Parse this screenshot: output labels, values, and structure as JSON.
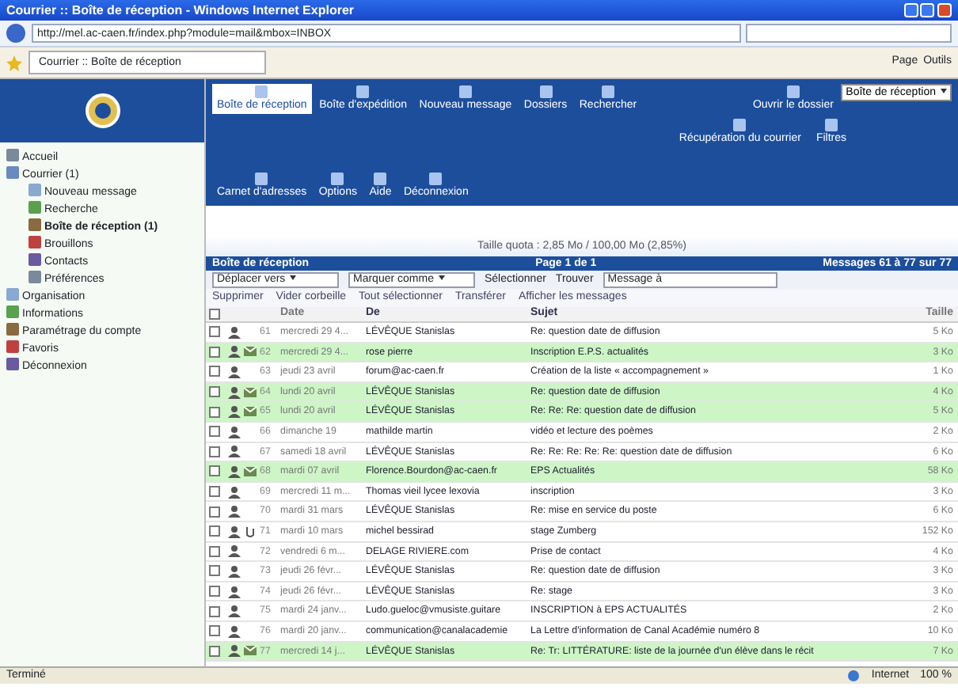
{
  "window": {
    "title": "Courrier :: Boîte de réception - Windows Internet Explorer"
  },
  "browser": {
    "address": "http://mel.ac-caen.fr/index.php?module=mail&mbox=INBOX",
    "tab": "Courrier :: Boîte de réception",
    "commands": [
      "Page",
      "Outils"
    ]
  },
  "sidebar": {
    "items": [
      {
        "label": "Accueil",
        "selected": false
      },
      {
        "label": "Courrier",
        "count": "(1)",
        "selected": false,
        "children": [
          {
            "label": "Nouveau message",
            "selected": false
          },
          {
            "label": "Recherche",
            "selected": false
          },
          {
            "label": "Boîte de réception",
            "count": "(1)",
            "selected": true
          },
          {
            "label": "Brouillons",
            "selected": false
          },
          {
            "label": "Contacts",
            "selected": false
          },
          {
            "label": "Préférences",
            "selected": false
          }
        ]
      },
      {
        "label": "Organisation",
        "selected": false
      },
      {
        "label": "Informations",
        "selected": false
      },
      {
        "label": "Paramétrage du compte",
        "selected": false
      },
      {
        "label": "Favoris",
        "selected": false
      },
      {
        "label": "Déconnexion",
        "selected": false
      }
    ]
  },
  "toolbar": {
    "main": [
      {
        "label": "Boîte de réception",
        "selected": true
      },
      {
        "label": "Boîte d'expédition",
        "selected": false
      },
      {
        "label": "Nouveau message",
        "selected": false
      },
      {
        "label": "Dossiers",
        "selected": false
      },
      {
        "label": "Rechercher",
        "selected": false
      }
    ],
    "open_folder": "Ouvrir le dossier",
    "folder_select": "Boîte de réception",
    "secondary": [
      {
        "label": "Récupération du courrier",
        "selected": false
      },
      {
        "label": "Filtres",
        "selected": false
      }
    ],
    "bottom": [
      {
        "label": "Carnet d'adresses",
        "selected": false
      },
      {
        "label": "Options",
        "selected": false
      },
      {
        "label": "Aide",
        "selected": false
      },
      {
        "label": "Déconnexion",
        "selected": false
      }
    ]
  },
  "quota": "Taille quota : 2,85 Mo / 100,00 Mo (2,85%)",
  "mailbox_bar": {
    "title": "Boîte de réception",
    "page": "Page 1 de 1",
    "messages": "Messages 61 à 77 sur 77"
  },
  "filters": {
    "move": "Déplacer vers",
    "mark": "Marquer comme",
    "select": "Sélectionner",
    "find": "Trouver",
    "search_value": "Message à"
  },
  "actions": [
    "Supprimer",
    "Vider corbeille",
    "Tout sélectionner",
    "Transférer",
    "Afficher les messages"
  ],
  "table": {
    "select_all_checked": false,
    "columns": [
      "Date",
      "De",
      "Sujet",
      "Taille"
    ],
    "rows": [
      {
        "num": "61",
        "date": "mercredi 29 4...",
        "from": "LÉVÊQUE Stanislas",
        "subject": "Re: question date de diffusion",
        "size": "5 Ko",
        "unread": false,
        "attachment": false
      },
      {
        "num": "62",
        "date": "mercredi 29 4...",
        "from": "rose pierre",
        "subject": "Inscription E.P.S. actualités",
        "size": "3 Ko",
        "unread": true,
        "attachment": false
      },
      {
        "num": "63",
        "date": "jeudi 23 avril",
        "from": "forum@ac-caen.fr",
        "subject": "Création de la liste « accompagnement »",
        "size": "1 Ko",
        "unread": false,
        "attachment": false
      },
      {
        "num": "64",
        "date": "lundi 20 avril",
        "from": "LÉVÊQUE Stanislas",
        "subject": "Re: question date de diffusion",
        "size": "4 Ko",
        "unread": true,
        "attachment": false
      },
      {
        "num": "65",
        "date": "lundi 20 avril",
        "from": "LÉVÊQUE Stanislas",
        "subject": "Re: Re: Re: question date de diffusion",
        "size": "5 Ko",
        "unread": true,
        "attachment": false
      },
      {
        "num": "66",
        "date": "dimanche 19",
        "from": "mathilde martin",
        "subject": "vidéo et lecture des poèmes",
        "size": "2 Ko",
        "unread": false,
        "attachment": false
      },
      {
        "num": "67",
        "date": "samedi 18 avril",
        "from": "LÉVÊQUE Stanislas",
        "subject": "Re: Re: Re: Re: Re: question date de diffusion",
        "size": "6 Ko",
        "unread": false,
        "attachment": false
      },
      {
        "num": "68",
        "date": "mardi 07 avril",
        "from": "Florence.Bourdon@ac-caen.fr",
        "subject": "EPS Actualités",
        "size": "58 Ko",
        "unread": true,
        "attachment": false
      },
      {
        "num": "69",
        "date": "mercredi 11 m...",
        "from": "Thomas vieil lycee lexovia",
        "subject": "inscription",
        "size": "3 Ko",
        "unread": false,
        "attachment": false
      },
      {
        "num": "70",
        "date": "mardi 31 mars",
        "from": "LÉVÊQUE Stanislas",
        "subject": "Re: mise en service du poste",
        "size": "6 Ko",
        "unread": false,
        "attachment": false
      },
      {
        "num": "71",
        "date": "mardi 10 mars",
        "from": "michel bessirad",
        "subject": "stage Zumberg",
        "size": "152 Ko",
        "unread": false,
        "attachment": true
      },
      {
        "num": "72",
        "date": "vendredi 6 m...",
        "from": "DELAGE RIVIERE.com",
        "subject": "Prise de contact",
        "size": "4 Ko",
        "unread": false,
        "attachment": false
      },
      {
        "num": "73",
        "date": "jeudi 26 févr...",
        "from": "LÉVÊQUE Stanislas",
        "subject": "Re: question date de diffusion",
        "size": "3 Ko",
        "unread": false,
        "attachment": false
      },
      {
        "num": "74",
        "date": "jeudi 26 févr...",
        "from": "LÉVÊQUE Stanislas",
        "subject": "Re: stage",
        "size": "3 Ko",
        "unread": false,
        "attachment": false
      },
      {
        "num": "75",
        "date": "mardi 24 janv...",
        "from": "Ludo.gueloc@vmusiste.guitare",
        "subject": "INSCRIPTION à EPS ACTUALITÉS",
        "size": "2 Ko",
        "unread": false,
        "attachment": false
      },
      {
        "num": "76",
        "date": "mardi 20 janv...",
        "from": "communication@canalacademie",
        "subject": "La Lettre d'information de Canal Académie numéro 8",
        "size": "10 Ko",
        "unread": false,
        "attachment": false
      },
      {
        "num": "77",
        "date": "mercredi 14 j...",
        "from": "LÉVÊQUE Stanislas",
        "subject": "Re: Tr: LITTÉRATURE: liste de la journée d'un élève dans le récit",
        "size": "7 Ko",
        "unread": true,
        "attachment": false
      }
    ]
  },
  "status_bar": {
    "text": "Terminé",
    "zone": "Internet",
    "zoom": "100 %"
  }
}
